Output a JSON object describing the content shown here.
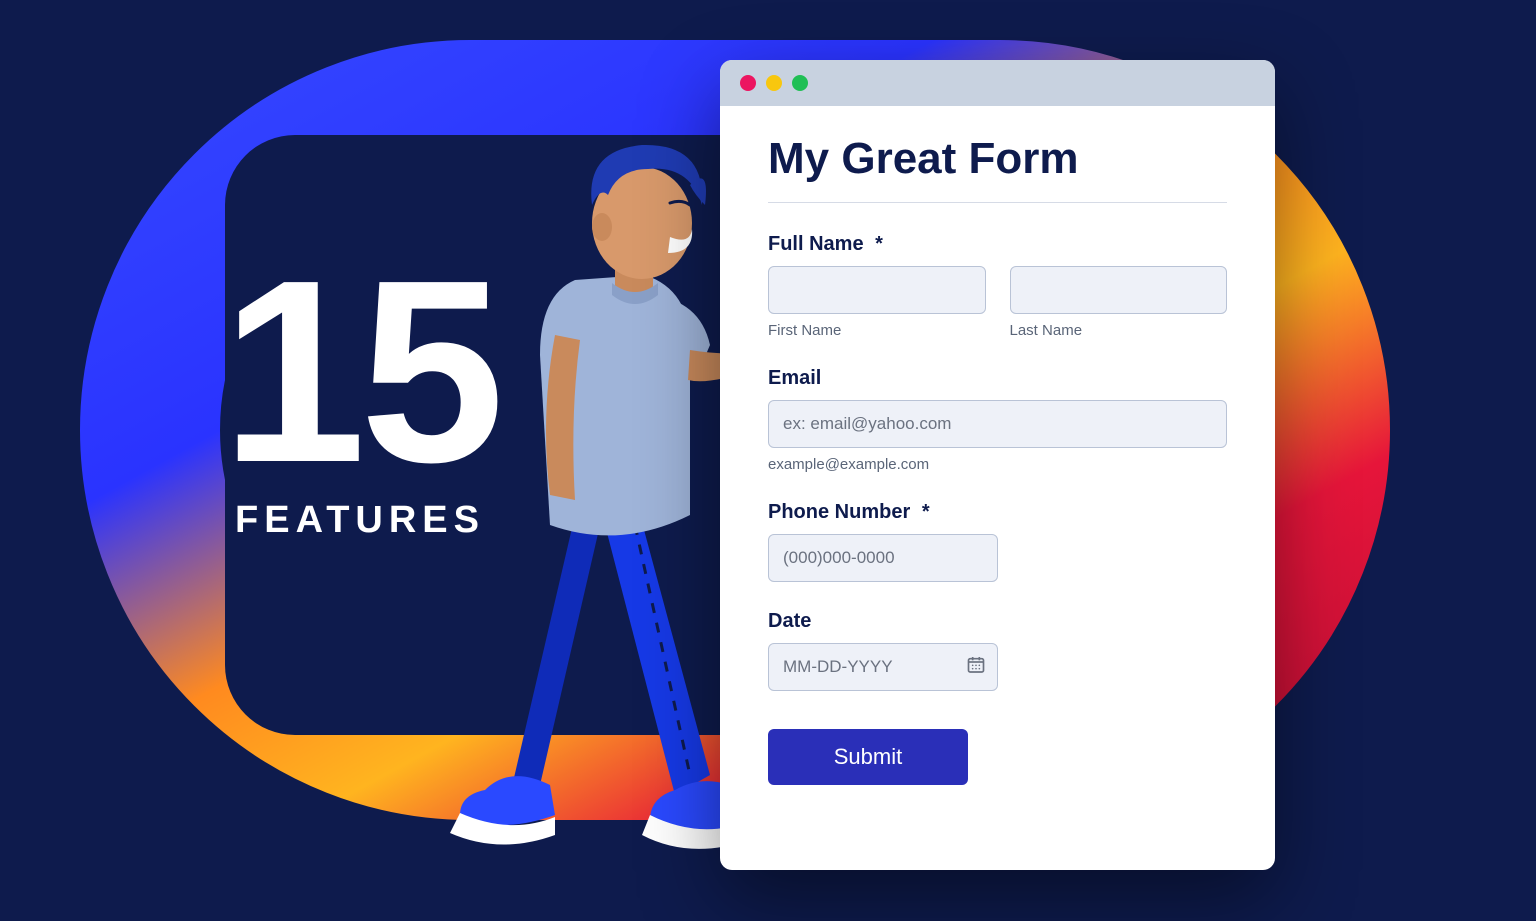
{
  "hero": {
    "number": "15",
    "word": "FEATURES"
  },
  "window": {
    "dots": [
      "red",
      "yellow",
      "green"
    ]
  },
  "form": {
    "title": "My Great Form",
    "fullname": {
      "label": "Full Name",
      "required_marker": "*",
      "first_sub": "First Name",
      "last_sub": "Last Name"
    },
    "email": {
      "label": "Email",
      "placeholder": "ex: email@yahoo.com",
      "hint": "example@example.com"
    },
    "phone": {
      "label": "Phone Number",
      "required_marker": "*",
      "placeholder": "(000)000-0000"
    },
    "date": {
      "label": "Date",
      "placeholder": "MM-DD-YYYY"
    },
    "submit_label": "Submit"
  },
  "colors": {
    "bg": "#0e1b4d",
    "accent": "#2a2fb8",
    "titlebar": "#c8d2e0",
    "input_bg": "#eef1f8",
    "border": "#b9c3d6"
  }
}
